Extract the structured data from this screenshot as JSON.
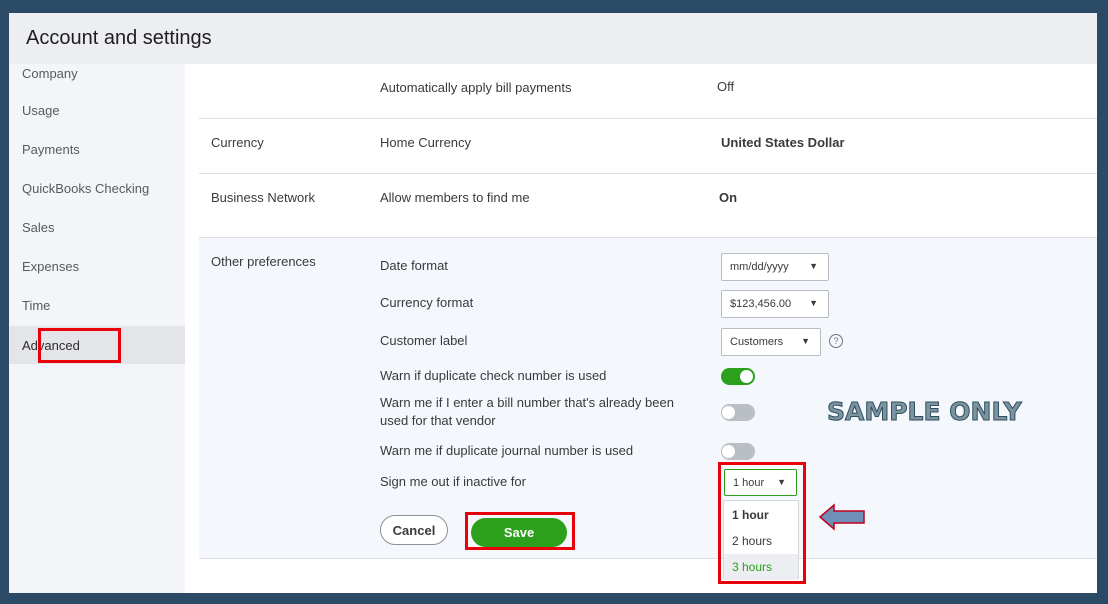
{
  "header": {
    "title": "Account and settings"
  },
  "sidebar": {
    "items": [
      {
        "label": "Company"
      },
      {
        "label": "Usage"
      },
      {
        "label": "Payments"
      },
      {
        "label": "QuickBooks Checking"
      },
      {
        "label": "Sales"
      },
      {
        "label": "Expenses"
      },
      {
        "label": "Time"
      },
      {
        "label": "Advanced",
        "active": true
      }
    ]
  },
  "rows": {
    "bill_payments": {
      "label": "Automatically apply bill payments",
      "value": "Off"
    },
    "currency": {
      "section": "Currency",
      "label": "Home Currency",
      "value": "United States Dollar"
    },
    "business_network": {
      "section": "Business Network",
      "label": "Allow members to find me",
      "value": "On"
    }
  },
  "other_preferences": {
    "section": "Other preferences",
    "date_format": {
      "label": "Date format",
      "value": "mm/dd/yyyy"
    },
    "currency_format": {
      "label": "Currency format",
      "value": "$123,456.00"
    },
    "customer_label": {
      "label": "Customer label",
      "value": "Customers"
    },
    "warn_check": {
      "label": "Warn if duplicate check number is used",
      "state": "on"
    },
    "warn_bill": {
      "label_line1": "Warn me if I enter a bill number that's already been",
      "label_line2": "used for that vendor",
      "state": "off"
    },
    "warn_journal": {
      "label": "Warn me if duplicate journal number is used",
      "state": "off"
    },
    "sign_out": {
      "label": "Sign me out if inactive for",
      "value": "1 hour",
      "options": [
        "1 hour",
        "2 hours",
        "3 hours"
      ]
    }
  },
  "actions": {
    "cancel": "Cancel",
    "save": "Save"
  },
  "watermark": "SAMPLE ONLY",
  "icons": {
    "caret": "caret-down-icon",
    "help": "help-icon",
    "arrow": "left-arrow-icon"
  },
  "colors": {
    "accent": "#2ca01c",
    "highlight": "#e8000b",
    "frame": "#2b4a66"
  }
}
